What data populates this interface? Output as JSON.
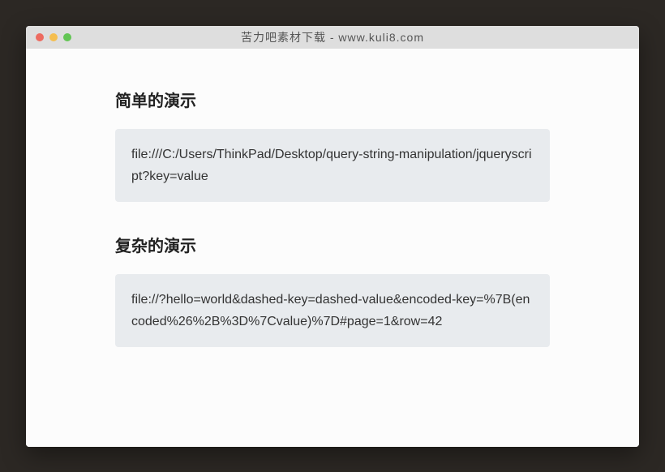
{
  "window": {
    "title": "苦力吧素材下载 - www.kuli8.com"
  },
  "content": {
    "sections": [
      {
        "heading": "简单的演示",
        "code": "file:///C:/Users/ThinkPad/Desktop/query-string-manipulation/jqueryscript?key=value"
      },
      {
        "heading": "复杂的演示",
        "code": "file://?hello=world&dashed-key=dashed-value&encoded-key=%7B(encoded%26%2B%3D%7Cvalue)%7D#page=1&row=42"
      }
    ]
  }
}
